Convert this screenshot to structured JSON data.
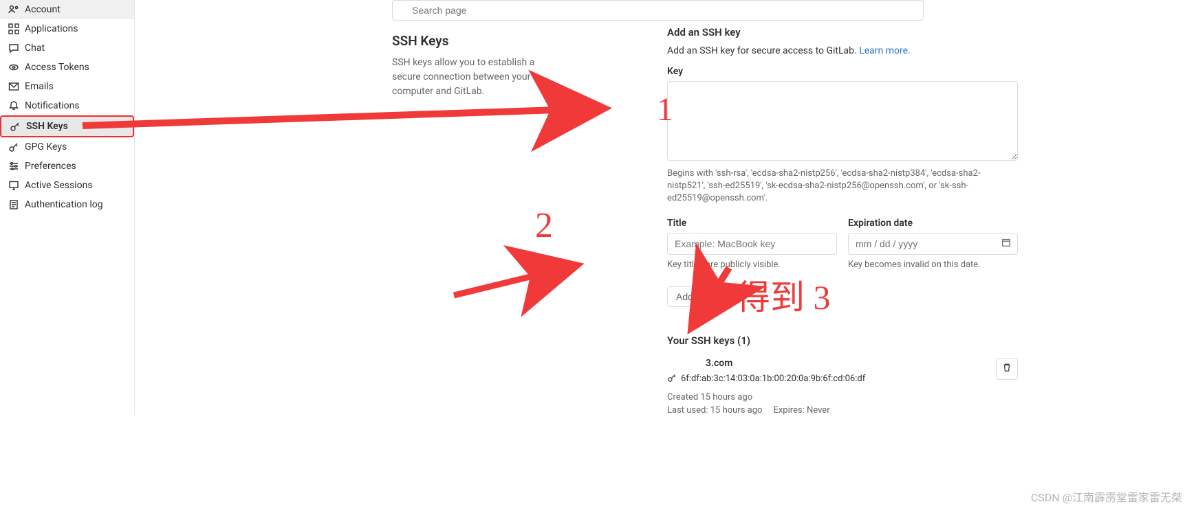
{
  "search": {
    "placeholder": "Search page"
  },
  "sidebar": {
    "items": [
      {
        "label": "Account"
      },
      {
        "label": "Applications"
      },
      {
        "label": "Chat"
      },
      {
        "label": "Access Tokens"
      },
      {
        "label": "Emails"
      },
      {
        "label": "Notifications"
      },
      {
        "label": "SSH Keys"
      },
      {
        "label": "GPG Keys"
      },
      {
        "label": "Preferences"
      },
      {
        "label": "Active Sessions"
      },
      {
        "label": "Authentication log"
      }
    ]
  },
  "panel": {
    "title": "SSH Keys",
    "desc": "SSH keys allow you to establish a secure connection between your computer and GitLab."
  },
  "form": {
    "heading": "Add an SSH key",
    "help_prefix": "Add an SSH key for secure access to GitLab. ",
    "help_link": "Learn more.",
    "key_label": "Key",
    "key_hint": "Begins with 'ssh-rsa', 'ecdsa-sha2-nistp256', 'ecdsa-sha2-nistp384', 'ecdsa-sha2-nistp521', 'ssh-ed25519', 'sk-ecdsa-sha2-nistp256@openssh.com', or 'sk-ssh-ed25519@openssh.com'.",
    "title_label": "Title",
    "title_placeholder": "Example: MacBook key",
    "title_hint": "Key titles are publicly visible.",
    "exp_label": "Expiration date",
    "exp_placeholder": "mm / dd / yyyy",
    "exp_hint": "Key becomes invalid on this date.",
    "submit": "Add key"
  },
  "keys": {
    "heading": "Your SSH keys (1)",
    "item": {
      "title": "3.com",
      "fingerprint": "6f:df:ab:3c:14:03:0a:1b:00:20:0a:9b:6f:cd:06:df",
      "created": "Created 15 hours ago",
      "last_used": "Last used: 15 hours ago",
      "expires": "Expires: Never"
    }
  },
  "annotations": {
    "n1": "1",
    "n2": "2",
    "n3": "得到 3"
  },
  "watermark": "CSDN @江南霹雳堂雷家雷无桀"
}
